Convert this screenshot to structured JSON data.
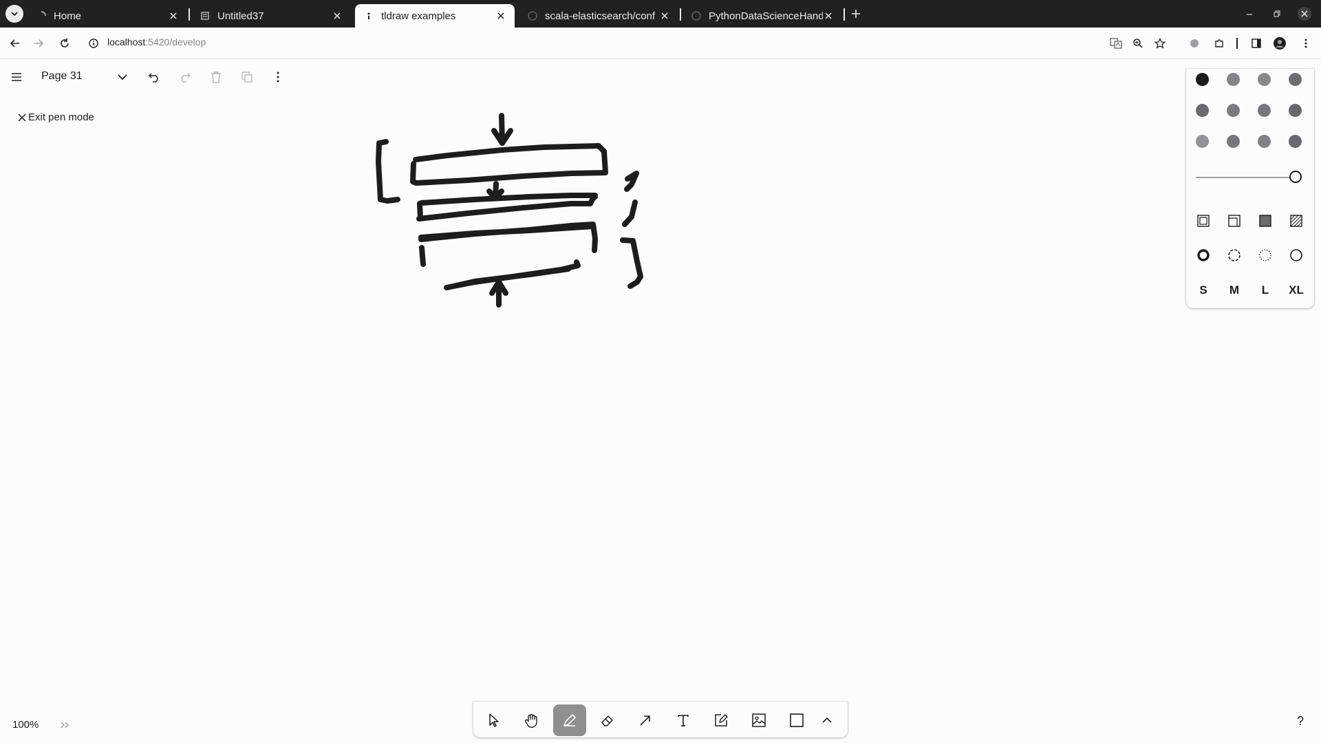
{
  "browser": {
    "tabs": [
      {
        "label": "Home",
        "icon": "loading-icon"
      },
      {
        "label": "Untitled37",
        "icon": "notebook-icon"
      },
      {
        "label": "tldraw examples",
        "icon": "favicon-icon"
      },
      {
        "label": "scala-elasticsearch/conf",
        "icon": "github-icon"
      },
      {
        "label": "PythonDataScienceHand",
        "icon": "github-icon"
      }
    ],
    "active_tab": 2,
    "url_host": "localhost",
    "url_rest": ":5420/develop"
  },
  "menu": {
    "page_name": "Page 31"
  },
  "pen_mode": {
    "exit_label": "Exit pen mode"
  },
  "style_panel": {
    "colors": [
      "#1d1d1d",
      "#9fa8b2",
      "#e085f4",
      "#ae3ec9",
      "#4465e9",
      "#4ba1f1",
      "#4cb05e",
      "#099268",
      "#ffc034",
      "#f76707",
      "#f87777",
      "#e03131"
    ],
    "colors_rendered_as": "greyscale",
    "selected_color": 0,
    "opacity_slider": 1.0,
    "fill_options": [
      "none",
      "semi",
      "solid",
      "pattern"
    ],
    "dash_options": [
      "draw",
      "dashed",
      "dotted",
      "solid"
    ],
    "selected_dash": 0,
    "sizes": [
      "S",
      "M",
      "L",
      "XL"
    ]
  },
  "tools": [
    {
      "name": "select",
      "icon": "cursor-icon"
    },
    {
      "name": "hand",
      "icon": "hand-icon"
    },
    {
      "name": "draw",
      "icon": "pencil-icon"
    },
    {
      "name": "eraser",
      "icon": "eraser-icon"
    },
    {
      "name": "arrow",
      "icon": "arrow-icon"
    },
    {
      "name": "text",
      "icon": "text-icon"
    },
    {
      "name": "note",
      "icon": "note-icon"
    },
    {
      "name": "asset",
      "icon": "image-icon"
    },
    {
      "name": "rectangle",
      "icon": "rectangle-icon"
    },
    {
      "name": "more",
      "icon": "chevron-up-icon"
    }
  ],
  "active_tool": 2,
  "zoom_label": "100%",
  "help_label": "?"
}
